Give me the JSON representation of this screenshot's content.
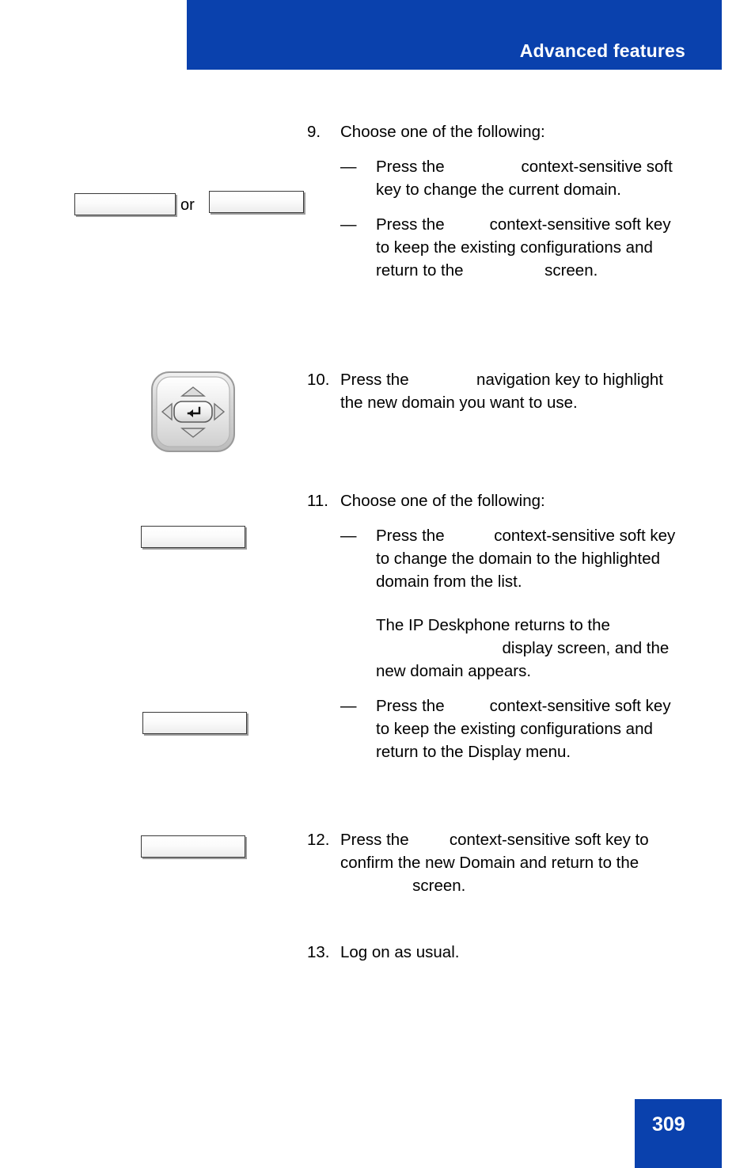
{
  "header": {
    "title": "Advanced features",
    "bar_color": "#0a41ad"
  },
  "footer": {
    "page_number": "309",
    "badge_color": "#0a41ad"
  },
  "gutter": {
    "or_label": "or",
    "softkeys": [
      {
        "name": "softkey-step9-a",
        "label": ""
      },
      {
        "name": "softkey-step9-b",
        "label": ""
      },
      {
        "name": "softkey-step11-a",
        "label": ""
      },
      {
        "name": "softkey-step11-b",
        "label": ""
      },
      {
        "name": "softkey-step12",
        "label": ""
      }
    ],
    "navigation_key": {
      "name": "navigation-key",
      "up": "△",
      "down": "▽",
      "left": "◁",
      "right": "▷",
      "center": "↵"
    }
  },
  "steps": [
    {
      "number": "9.",
      "lead": "Choose one of the following:",
      "bullets": [
        {
          "dash": "—",
          "parts": [
            {
              "type": "text",
              "value": "Press the "
            },
            {
              "type": "slot",
              "value": "                "
            },
            {
              "type": "text",
              "value": "context-sensitive soft key to change the current domain."
            }
          ]
        },
        {
          "dash": "—",
          "parts": [
            {
              "type": "text",
              "value": "Press the "
            },
            {
              "type": "slot",
              "value": "         "
            },
            {
              "type": "text",
              "value": "context-sensitive soft key to keep the existing configurations and return to the "
            },
            {
              "type": "slot",
              "value": "                 "
            },
            {
              "type": "text",
              "value": "screen."
            }
          ]
        }
      ]
    },
    {
      "number": "10.",
      "parts": [
        {
          "type": "text",
          "value": "Press the "
        },
        {
          "type": "slot",
          "value": "              "
        },
        {
          "type": "text",
          "value": "navigation key to highlight the new domain you want to use."
        }
      ]
    },
    {
      "number": "11.",
      "lead": "Choose one of the following:",
      "bullets": [
        {
          "dash": "—",
          "parts": [
            {
              "type": "text",
              "value": "Press the "
            },
            {
              "type": "slot",
              "value": "          "
            },
            {
              "type": "text",
              "value": "context-sensitive soft key to change the domain to the highlighted domain from the list."
            }
          ]
        }
      ],
      "note": [
        {
          "type": "text",
          "value": "The IP Deskphone returns to the "
        },
        {
          "type": "slot",
          "value": "                            "
        },
        {
          "type": "text",
          "value": "display screen, and the new domain appears."
        }
      ],
      "bullets2": [
        {
          "dash": "—",
          "parts": [
            {
              "type": "text",
              "value": "Press the "
            },
            {
              "type": "slot",
              "value": "         "
            },
            {
              "type": "text",
              "value": "context-sensitive soft key to keep the existing configurations and return to the Display menu."
            }
          ]
        }
      ]
    },
    {
      "number": "12.",
      "parts": [
        {
          "type": "text",
          "value": "Press the "
        },
        {
          "type": "slot",
          "value": "        "
        },
        {
          "type": "text",
          "value": "context-sensitive soft key to confirm the new Domain and return to the "
        },
        {
          "type": "slot",
          "value": "                "
        },
        {
          "type": "text",
          "value": "screen."
        }
      ]
    },
    {
      "number": "13.",
      "parts": [
        {
          "type": "text",
          "value": " Log on as usual."
        }
      ]
    }
  ]
}
